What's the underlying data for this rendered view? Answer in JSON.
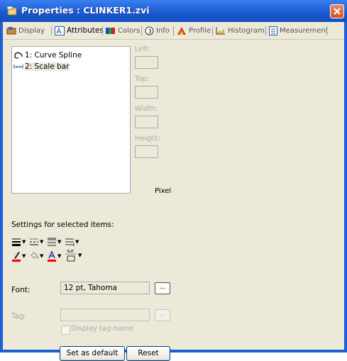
{
  "window": {
    "title": "Properties : CLINKER1.zvi"
  },
  "tabs": [
    {
      "label": "Display",
      "icon": "display-icon"
    },
    {
      "label": "Attributes",
      "icon": "attributes-icon",
      "active": true
    },
    {
      "label": "Colors",
      "icon": "colors-icon"
    },
    {
      "label": "Info",
      "icon": "info-icon"
    },
    {
      "label": "Profile",
      "icon": "profile-icon"
    },
    {
      "label": "Histogram",
      "icon": "histogram-icon"
    },
    {
      "label": "Measurement",
      "icon": "measurement-icon"
    }
  ],
  "items": [
    {
      "label": "1: Curve Spline",
      "icon": "curve-spline-icon"
    },
    {
      "label": "2: Scale bar",
      "icon": "scale-bar-icon",
      "selected": true
    }
  ],
  "geometry_fields": {
    "left_label": "Left:",
    "top_label": "Top:",
    "width_label": "Width:",
    "height_label": "Height:",
    "unit": "Pixel"
  },
  "settings": {
    "label": "Settings for selected items:",
    "line_tools": [
      "line-width-icon",
      "line-style-icon",
      "fill-style-icon",
      "line-end-icon"
    ],
    "color_tools": [
      "pen-color-icon",
      "fill-color-icon",
      "font-color-icon",
      "text-frame-icon"
    ],
    "pen_color": "#ff0000",
    "text_color": "#ff0000"
  },
  "font": {
    "label": "Font:",
    "value": "12 pt, Tahoma",
    "browse_label": "..."
  },
  "tag": {
    "label": "Tag:",
    "value": "",
    "browse_label": "...",
    "display_tag_name_label": "Display tag name",
    "display_tag_name_checked": false
  },
  "buttons": {
    "set_default": "Set as default",
    "reset": "Reset"
  }
}
